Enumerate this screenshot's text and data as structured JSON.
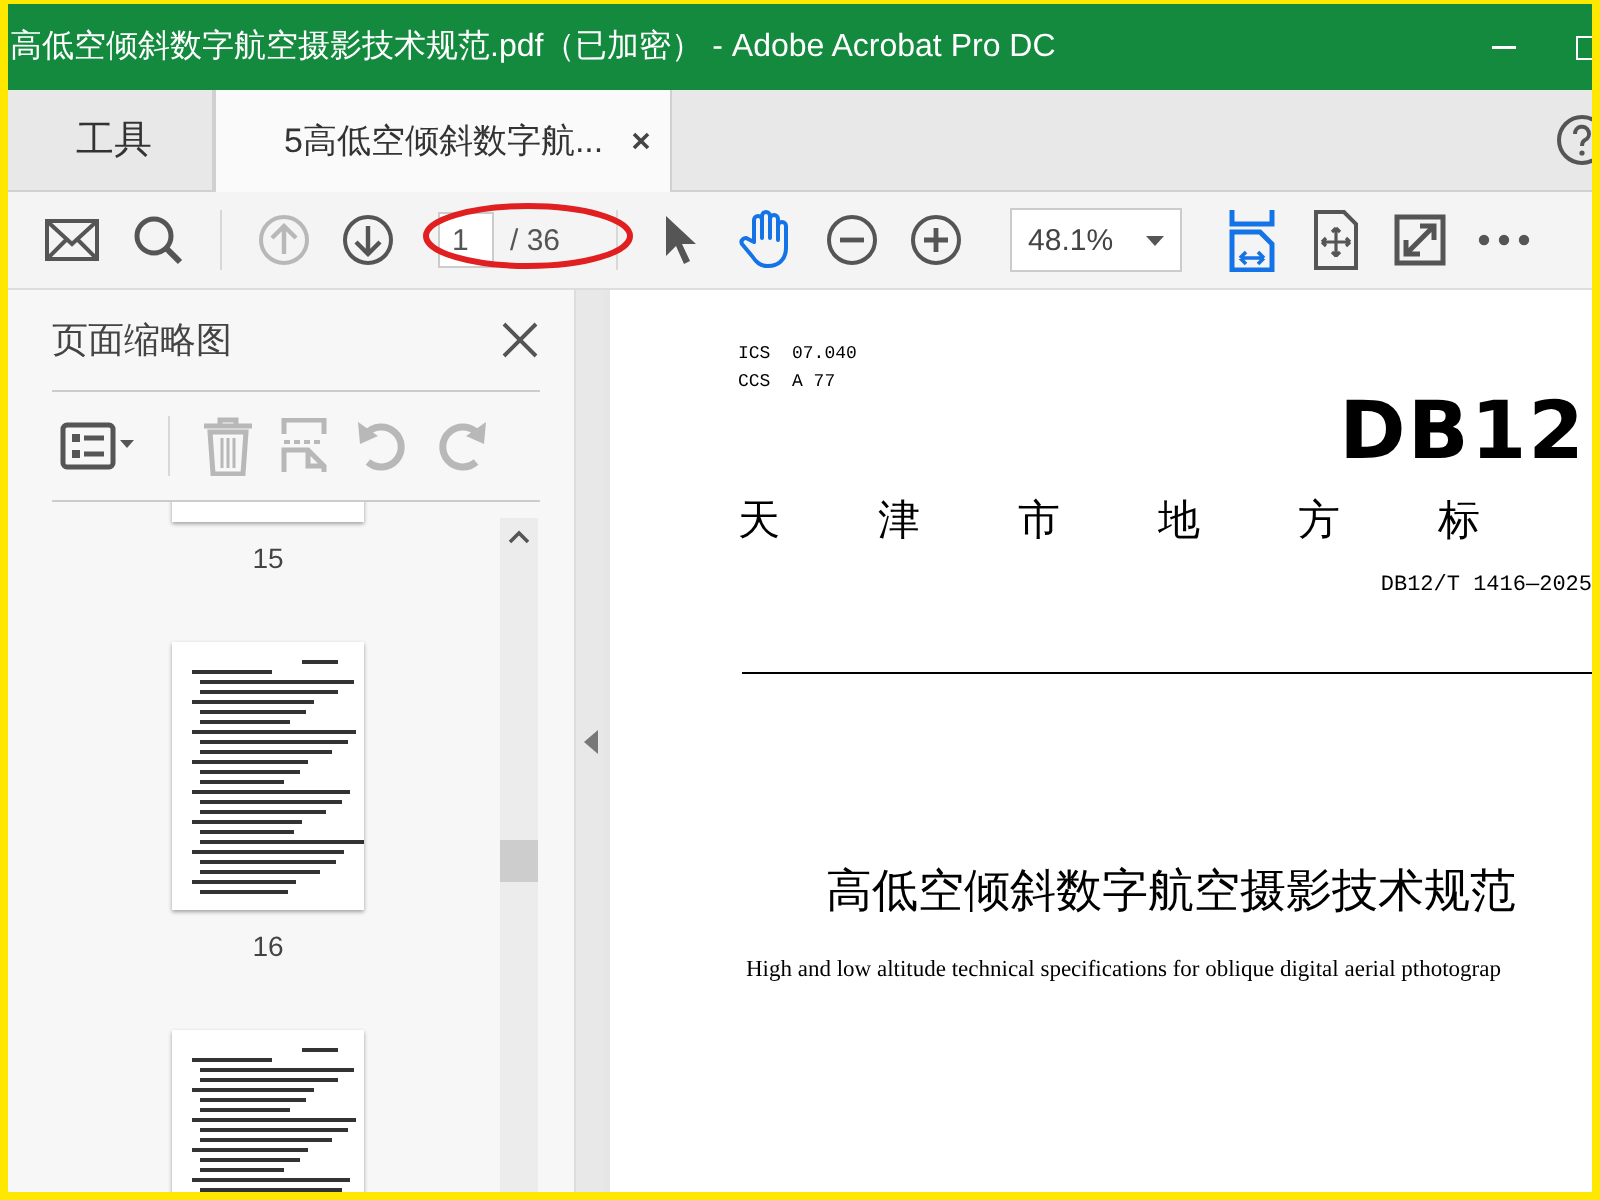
{
  "window": {
    "title": "高低空倾斜数字航空摄影技术规范.pdf（已加密） - Adobe Acrobat Pro DC"
  },
  "tabs": [
    {
      "label": "工具",
      "selected": false,
      "closable": false
    },
    {
      "label": "5高低空倾斜数字航...",
      "selected": true,
      "closable": true
    }
  ],
  "toolbar": {
    "tools_left": [
      {
        "kind": "mail",
        "disabled": false,
        "active": false
      },
      {
        "kind": "search",
        "disabled": false,
        "active": false
      },
      {
        "kind": "divider"
      },
      {
        "kind": "prev",
        "disabled": true,
        "active": false
      },
      {
        "kind": "next",
        "disabled": false,
        "active": false
      }
    ],
    "page_field": {
      "value": "1",
      "total": "/ 36"
    },
    "annotation": {
      "kind": "ellipse",
      "color": "#e02020"
    },
    "tools_mid": [
      {
        "kind": "select",
        "disabled": false,
        "active": false
      },
      {
        "kind": "hand",
        "disabled": false,
        "active": true
      },
      {
        "kind": "zoom-out",
        "disabled": false,
        "active": false
      },
      {
        "kind": "zoom-in",
        "disabled": false,
        "active": false
      }
    ],
    "zoom_field": {
      "value": "48.1%"
    },
    "tools_right": [
      {
        "kind": "fit",
        "disabled": false,
        "active": true
      },
      {
        "kind": "pan",
        "disabled": false,
        "active": false
      },
      {
        "kind": "fullscreen",
        "disabled": false,
        "active": false
      },
      {
        "kind": "more",
        "disabled": false,
        "active": false
      }
    ]
  },
  "panel": {
    "title": "页面缩略图",
    "tools": [
      {
        "kind": "options",
        "disabled": false,
        "active": false
      },
      {
        "kind": "divider"
      },
      {
        "kind": "delete",
        "disabled": true,
        "active": false
      },
      {
        "kind": "split",
        "disabled": true,
        "active": false
      },
      {
        "kind": "rotate-left",
        "disabled": true,
        "active": false
      },
      {
        "kind": "rotate-right",
        "disabled": true,
        "active": false
      }
    ],
    "thumbnails": [
      {
        "kind": "tail",
        "label": "15"
      },
      {
        "kind": "page",
        "label": "16"
      },
      {
        "kind": "head"
      }
    ]
  },
  "document": {
    "codes": [
      "ICS  07.040",
      "CCS  A 77"
    ],
    "logo": "DB12",
    "issuer": "天津市地方标",
    "number": "DB12/T 1416—2025",
    "title": "高低空倾斜数字航空摄影技术规范",
    "english_title": "High and low altitude technical specifications for oblique digital aerial pthotograp"
  }
}
